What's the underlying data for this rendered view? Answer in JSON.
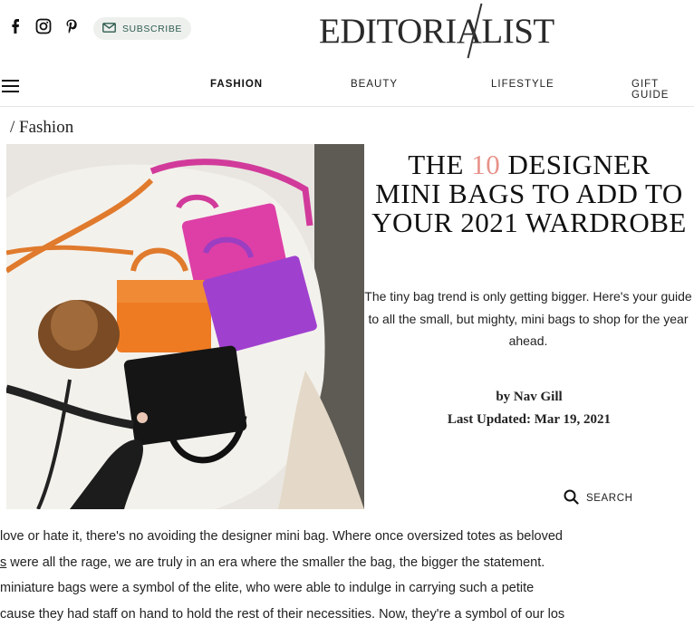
{
  "header": {
    "social": [
      {
        "name": "facebook-icon"
      },
      {
        "name": "instagram-icon"
      },
      {
        "name": "pinterest-icon"
      }
    ],
    "subscribe_label": "SUBSCRIBE",
    "logo": "EDITORIALIST"
  },
  "nav": {
    "items": [
      "FASHION",
      "BEAUTY",
      "LIFESTYLE",
      "GIFT GUIDE"
    ],
    "active": "FASHION"
  },
  "breadcrumb": "/ Fashion",
  "article": {
    "title_pre": "THE ",
    "title_num": "10",
    "title_post": " DESIGNER MINI BAGS TO ADD TO YOUR 2021 WARDROBE",
    "dek": "The tiny bag trend is only getting bigger. Here's your guide to all the small, but mighty, mini bags to shop for the year ahead.",
    "byline": "by Nav Gill",
    "updated": "Last Updated: Mar 19, 2021",
    "body_lines": [
      " love or hate it, there's no avoiding the designer mini bag. Where once oversized totes as beloved",
      " were all the rage, we are truly in an era where the smaller the bag, the bigger the statement.",
      "miniature bags were a symbol of the elite, who were able to indulge in carrying such a petite",
      "cause they had staff on hand to hold the rest of their necessities. Now, they're a symbol of our los"
    ],
    "body_line2_link": "s"
  },
  "search_label": "SEARCH",
  "colors": {
    "accent": "#e8928a",
    "subscribe_bg": "#eef0ee",
    "subscribe_text": "#2f5e4e"
  }
}
